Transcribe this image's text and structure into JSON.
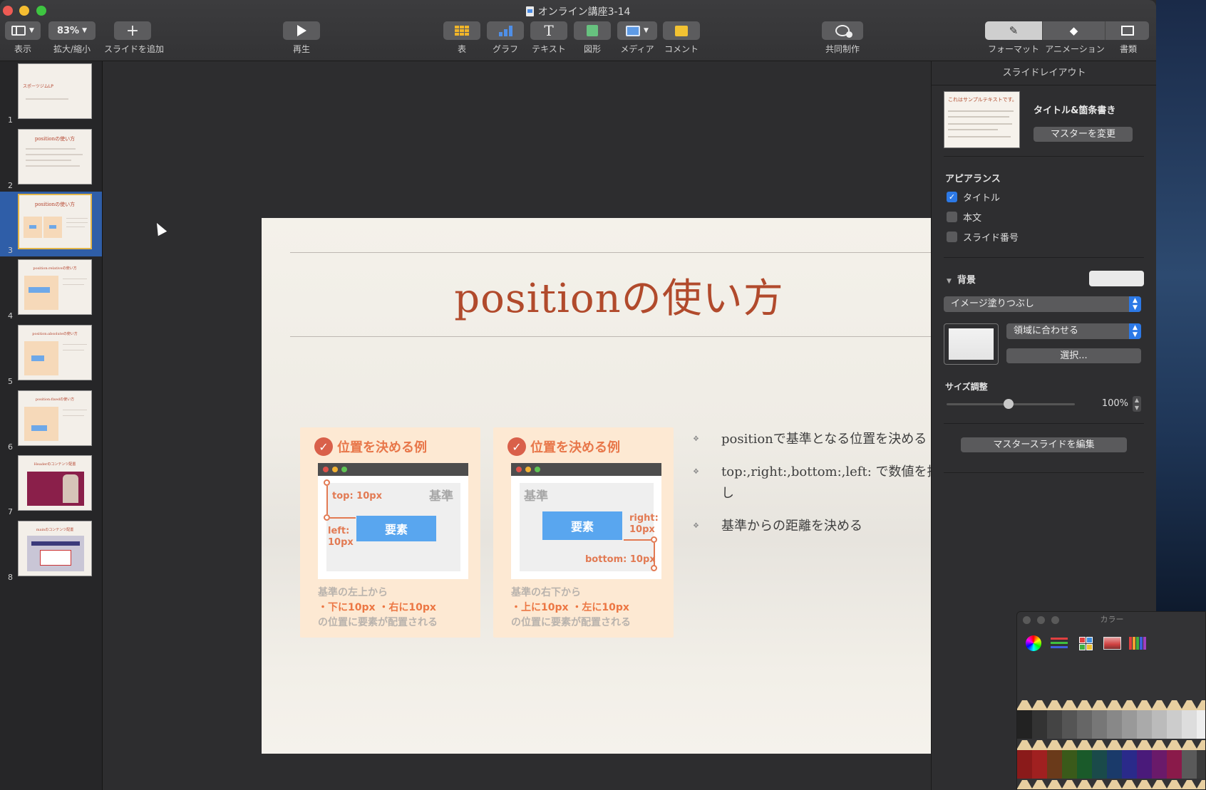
{
  "window": {
    "title": "オンライン講座3-14"
  },
  "toolbar": {
    "view_label": "表示",
    "zoom_value": "83%",
    "zoom_label": "拡大/縮小",
    "add_slide_label": "スライドを追加",
    "play_label": "再生",
    "table_label": "表",
    "chart_label": "グラフ",
    "text_label": "テキスト",
    "shape_label": "図形",
    "media_label": "メディア",
    "comment_label": "コメント",
    "collab_label": "共同制作",
    "format_label": "フォーマット",
    "animate_label": "アニメーション",
    "document_label": "書類"
  },
  "navigator": {
    "selected": 3,
    "slides": [
      {
        "num": "1",
        "title": "スポーツジムLP"
      },
      {
        "num": "2",
        "title": "positionの使い方"
      },
      {
        "num": "3",
        "title": "positionの使い方"
      },
      {
        "num": "4",
        "title": "position:relativeの使い方"
      },
      {
        "num": "5",
        "title": "position:absoluteの使い方"
      },
      {
        "num": "6",
        "title": "position:fixedの使い方"
      },
      {
        "num": "7",
        "title": "Headerのコンテンツ配置"
      },
      {
        "num": "8",
        "title": "mainのコンテンツ配置"
      }
    ]
  },
  "slide": {
    "title": "positionの使い方",
    "card_left": {
      "heading": "位置を決める例",
      "reference": "基準",
      "element": "要素",
      "dim_top": "top: 10px",
      "dim_left_1": "left:",
      "dim_left_2": "10px",
      "note_line1": "基準の左上から",
      "note_line2": "・下に10px ・右に10px",
      "note_line3": "の位置に要素が配置される"
    },
    "card_right": {
      "heading": "位置を決める例",
      "reference": "基準",
      "element": "要素",
      "dim_right_1": "right:",
      "dim_right_2": "10px",
      "dim_bottom": "bottom: 10px",
      "note_line1": "基準の右下から",
      "note_line2": "・上に10px ・左に10px",
      "note_line3": "の位置に要素が配置される"
    },
    "bullets": [
      "positionで基準となる位置を決める",
      "top:,right:,bottom:,left: で数値を指定し",
      "基準からの距離を決める"
    ]
  },
  "inspector": {
    "header": "スライドレイアウト",
    "layout_name": "タイトル&箇条書き",
    "layout_thumb_text": "これはサンプルテキストです。",
    "change_master": "マスターを変更",
    "appearance_label": "アピアランス",
    "appearance": [
      {
        "label": "タイトル",
        "checked": true
      },
      {
        "label": "本文",
        "checked": false
      },
      {
        "label": "スライド番号",
        "checked": false
      }
    ],
    "background_label": "背景",
    "fill_type": "イメージ塗りつぶし",
    "scale_mode": "領域に合わせる",
    "choose_button": "選択...",
    "size_label": "サイズ調整",
    "size_value": "100%",
    "edit_master": "マスタースライドを編集"
  },
  "colors_panel": {
    "title": "カラー"
  },
  "colors": {
    "accent_title": "#b14a2c",
    "card_bg": "#fde9d3",
    "element_blue": "#59a6ef",
    "selection_blue": "#2f5ea8"
  }
}
